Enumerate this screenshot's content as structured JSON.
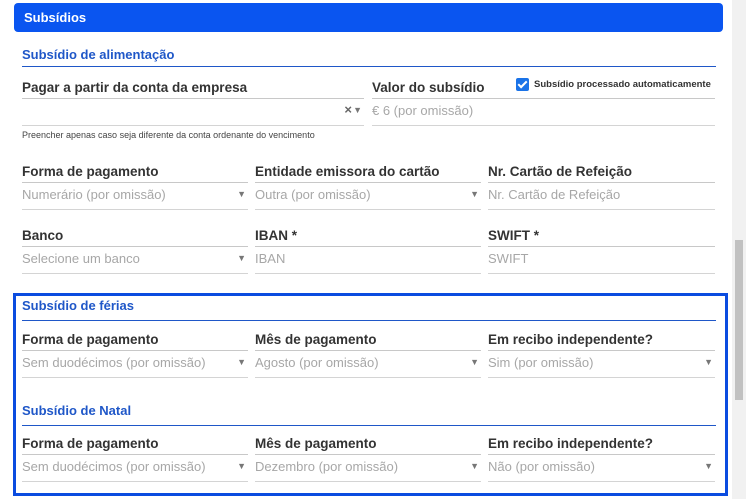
{
  "header": {
    "title": "Subsídios"
  },
  "meal": {
    "title": "Subsídio de alimentação",
    "pay_from_label": "Pagar a partir da conta da empresa",
    "pay_from_hint": "Preencher apenas caso seja diferente da conta ordenante do vencimento",
    "value_label": "Valor do subsídio",
    "value_placeholder": "€ 6 (por omissão)",
    "auto_checkbox_label": "Subsídio processado automaticamente",
    "auto_checked": true,
    "payment_method_label": "Forma de pagamento",
    "payment_method_value": "Numerário (por omissão)",
    "card_issuer_label": "Entidade emissora do cartão",
    "card_issuer_value": "Outra (por omissão)",
    "card_number_label": "Nr. Cartão de Refeição",
    "card_number_placeholder": "Nr. Cartão de Refeição",
    "bank_label": "Banco",
    "bank_placeholder": "Selecione um banco",
    "iban_label": "IBAN *",
    "iban_placeholder": "IBAN",
    "swift_label": "SWIFT *",
    "swift_placeholder": "SWIFT"
  },
  "holiday": {
    "title": "Subsídio de férias",
    "payment_method_label": "Forma de pagamento",
    "payment_method_value": "Sem duodécimos (por omissão)",
    "month_label": "Mês de pagamento",
    "month_value": "Agosto (por omissão)",
    "independent_label": "Em recibo independente?",
    "independent_value": "Sim (por omissão)"
  },
  "christmas": {
    "title": "Subsídio de Natal",
    "payment_method_label": "Forma de pagamento",
    "payment_method_value": "Sem duodécimos (por omissão)",
    "month_label": "Mês de pagamento",
    "month_value": "Dezembro (por omissão)",
    "independent_label": "Em recibo independente?",
    "independent_value": "Não (por omissão)"
  }
}
